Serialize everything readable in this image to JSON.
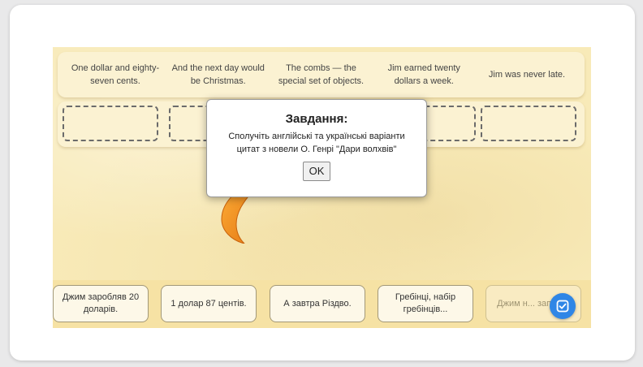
{
  "quotes": [
    "One dollar and eighty-seven cents.",
    "And the next day would be Christmas.",
    "The combs — the special set of objects.",
    "Jim earned twenty dollars a week.",
    "Jim was never late."
  ],
  "answers": [
    "Джим заробляв 20 доларів.",
    "1 долар 87 центів.",
    "А завтра Різдво.",
    "Гребінці, набір гребінців...",
    "Джим н... запізн..."
  ],
  "dialog": {
    "title": "Завдання:",
    "text": "Сполучіть англійські та українські варіанти цитат з новели О. Генрі \"Дари волхвів\"",
    "ok_label": "OK"
  },
  "colors": {
    "board": "#f8eab8",
    "arrow": "#f08a1c",
    "check_button": "#2f86e6"
  },
  "icons": {
    "arrow": "curved-arrow-icon",
    "check": "check-square-icon"
  }
}
